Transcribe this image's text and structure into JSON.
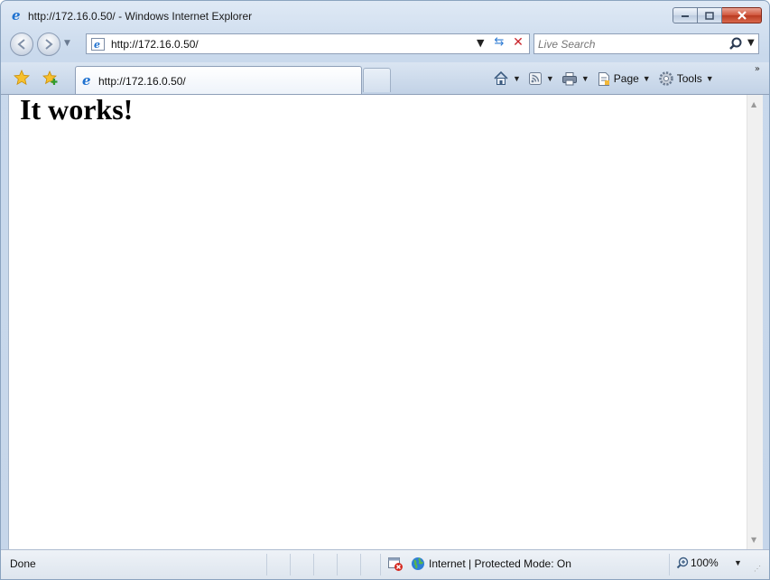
{
  "window": {
    "title": "http://172.16.0.50/ - Windows Internet Explorer"
  },
  "address_bar": {
    "url": "http://172.16.0.50/"
  },
  "search": {
    "placeholder": "Live Search"
  },
  "tab": {
    "label": "http://172.16.0.50/"
  },
  "command_bar": {
    "page_label": "Page",
    "tools_label": "Tools"
  },
  "content": {
    "heading": "It works!"
  },
  "status_bar": {
    "status": "Done",
    "zone": "Internet | Protected Mode: On",
    "zoom": "100%"
  },
  "colors": {
    "accent": "#2e7bd3",
    "stop_red": "#c9242b",
    "close_red": "#c9492f",
    "chrome_blue": "#c9d9ec"
  }
}
